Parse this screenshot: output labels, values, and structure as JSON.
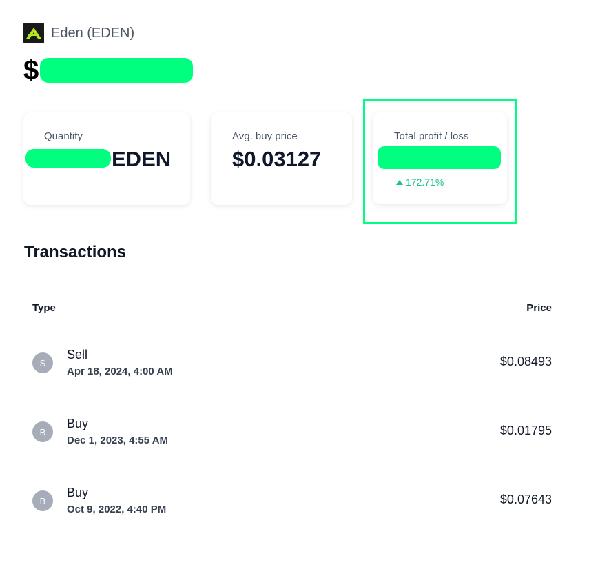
{
  "asset": {
    "name": "Eden (EDEN)",
    "currency_symbol": "$"
  },
  "cards": {
    "quantity": {
      "label": "Quantity",
      "unit": "EDEN"
    },
    "avg_buy_price": {
      "label": "Avg. buy price",
      "value": "$0.03127"
    },
    "total_profit_loss": {
      "label": "Total profit / loss",
      "change": "172.71%"
    }
  },
  "transactions": {
    "title": "Transactions",
    "columns": {
      "type": "Type",
      "price": "Price"
    },
    "rows": [
      {
        "initial": "S",
        "type": "Sell",
        "date": "Apr 18, 2024, 4:00 AM",
        "price": "$0.08493"
      },
      {
        "initial": "B",
        "type": "Buy",
        "date": "Dec 1, 2023, 4:55 AM",
        "price": "$0.01795"
      },
      {
        "initial": "B",
        "type": "Buy",
        "date": "Oct 9, 2022, 4:40 PM",
        "price": "$0.07643"
      }
    ]
  },
  "colors": {
    "redaction": "#00ff7f",
    "positive": "#16c784",
    "logo_bg": "#1a1a1a",
    "logo_mark": "#b5e61d"
  }
}
